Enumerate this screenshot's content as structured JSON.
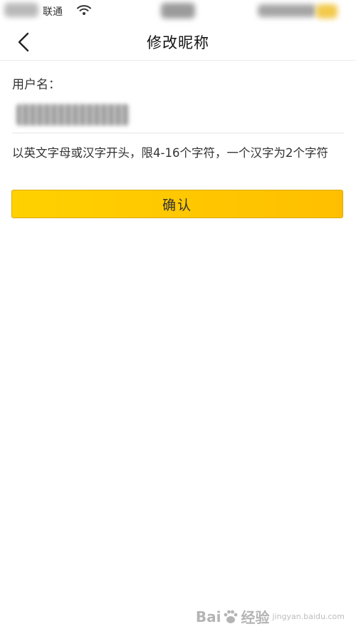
{
  "status_bar": {
    "carrier": "联通"
  },
  "nav": {
    "title": "修改昵称",
    "back_icon": "chevron-left-icon"
  },
  "form": {
    "username_label": "用户名：",
    "hint": "以英文字母或汉字开头，限4-16个字符，一个汉字为2个字符",
    "confirm_label": "确认"
  },
  "watermark": {
    "brand": "Bai",
    "brand_suffix": "经验",
    "domain": "jingyan.baidu.com"
  },
  "colors": {
    "accent": "#ffc600",
    "accent_border": "#d9a800",
    "text": "#333333"
  }
}
